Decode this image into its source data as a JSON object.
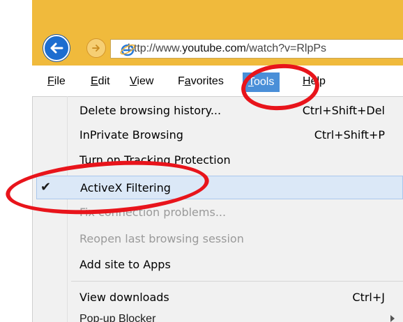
{
  "browser": {
    "address_bar": {
      "url_prefix": "http://www.",
      "url_domain": "youtube.com",
      "url_suffix": "/watch?v=RlpPs"
    },
    "colors": {
      "chrome": "#f0ba3c",
      "back_button": "#1c6dd0",
      "highlight": "#4a8fd8",
      "annotation": "#e8141b"
    }
  },
  "menu_bar": {
    "items": [
      {
        "label": "File",
        "underline": "F"
      },
      {
        "label": "Edit",
        "underline": "E"
      },
      {
        "label": "View",
        "underline": "V"
      },
      {
        "label": "Favorites",
        "underline": "a"
      },
      {
        "label": "Tools",
        "underline": "T",
        "active": true
      },
      {
        "label": "Help",
        "underline": "H"
      }
    ]
  },
  "tools_menu": {
    "items": [
      {
        "label": "Delete browsing history...",
        "shortcut": "Ctrl+Shift+Del",
        "enabled": true
      },
      {
        "label": "InPrivate Browsing",
        "shortcut": "Ctrl+Shift+P",
        "enabled": true
      },
      {
        "label": "Turn on Tracking Protection",
        "shortcut": "",
        "enabled": true
      },
      {
        "label": "ActiveX Filtering",
        "shortcut": "",
        "enabled": true,
        "checked": true
      },
      {
        "label": "Fix connection problems...",
        "shortcut": "",
        "enabled": false
      },
      {
        "label": "Reopen last browsing session",
        "shortcut": "",
        "enabled": false
      },
      {
        "label": "Add site to Apps",
        "shortcut": "",
        "enabled": true
      },
      {
        "label": "View downloads",
        "shortcut": "Ctrl+J",
        "enabled": true
      },
      {
        "label": "Pop-up Blocker",
        "shortcut": "",
        "enabled": true,
        "submenu": true
      }
    ]
  },
  "icons": {
    "back": "back-arrow-icon",
    "forward": "forward-arrow-icon",
    "site": "ie-logo-icon",
    "check": "checkmark-icon",
    "submenu": "submenu-arrow-icon"
  }
}
